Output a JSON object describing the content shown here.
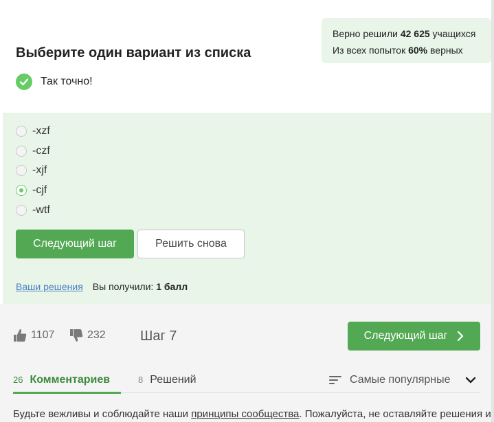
{
  "stats": {
    "line1_prefix": "Верно решили",
    "line1_value": "42 625",
    "line1_suffix": "учащихся",
    "line2_prefix": "Из всех попыток",
    "line2_value": "60%",
    "line2_suffix": "верных"
  },
  "question": {
    "title": "Выберите один вариант из списка",
    "result_text": "Так точно!"
  },
  "options": [
    {
      "label": "-xzf",
      "selected": false
    },
    {
      "label": "-czf",
      "selected": false
    },
    {
      "label": "-xjf",
      "selected": false
    },
    {
      "label": "-cjf",
      "selected": true
    },
    {
      "label": "-wtf",
      "selected": false
    }
  ],
  "buttons": {
    "next_step": "Следующий шаг",
    "solve_again": "Решить снова"
  },
  "footer": {
    "solutions_link": "Ваши решения",
    "score_prefix": "Вы получили:",
    "score_value": "1 балл"
  },
  "step_bar": {
    "likes": "1107",
    "dislikes": "232",
    "step_label": "Шаг 7",
    "next_button": "Следующий шаг"
  },
  "tabs": {
    "comments_count": "26",
    "comments_label": "Комментариев",
    "solutions_count": "8",
    "solutions_label": "Решений",
    "sort_label": "Самые популярные"
  },
  "notice": {
    "part1": "Будьте вежливы и соблюдайте наши ",
    "link": "принципы сообщества",
    "part2": ". Пожалуйста, не оставляйте решения и"
  },
  "colors": {
    "accent_green": "#53a853",
    "success_bg": "#e9f5e9",
    "link_blue": "#4a7fc1"
  }
}
